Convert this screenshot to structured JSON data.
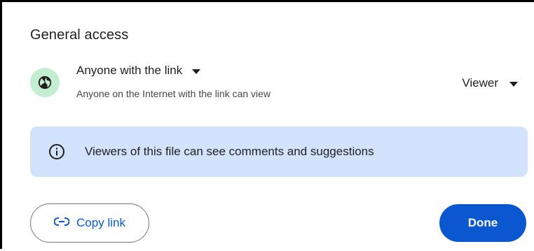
{
  "general_access": {
    "heading": "General access",
    "link_setting": {
      "title": "Anyone with the link",
      "description": "Anyone on the Internet with the link can view",
      "icon": "globe-icon"
    },
    "role": {
      "selected": "Viewer"
    }
  },
  "info_banner": {
    "icon": "info-icon",
    "text": "Viewers of this file can see comments and suggestions"
  },
  "actions": {
    "copy_link_label": "Copy link",
    "done_label": "Done"
  },
  "colors": {
    "accent": "#0b57d0",
    "banner_bg": "#d3e3fd",
    "globe_bg": "#c4eed0"
  }
}
